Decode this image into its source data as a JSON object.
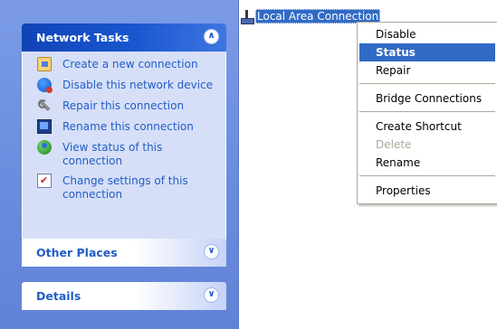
{
  "task_pane": {
    "network_tasks": {
      "title": "Network Tasks",
      "items": [
        {
          "label": "Create a new connection",
          "icon": "new-connection-icon"
        },
        {
          "label": "Disable this network device",
          "icon": "disable-device-icon"
        },
        {
          "label": "Repair this connection",
          "icon": "repair-icon"
        },
        {
          "label": "Rename this connection",
          "icon": "rename-icon"
        },
        {
          "label": "View status of this connection",
          "icon": "status-icon"
        },
        {
          "label": "Change settings of this connection",
          "icon": "settings-icon"
        }
      ]
    },
    "other_places": {
      "title": "Other Places"
    },
    "details": {
      "title": "Details"
    }
  },
  "connection": {
    "label": "Local Area Connection",
    "icon": "network-connection-icon"
  },
  "context_menu": {
    "items": [
      {
        "label": "Disable",
        "state": "normal"
      },
      {
        "label": "Status",
        "state": "default-selected"
      },
      {
        "label": "Repair",
        "state": "normal"
      },
      {
        "label": "Bridge Connections",
        "state": "normal"
      },
      {
        "label": "Create Shortcut",
        "state": "normal"
      },
      {
        "label": "Delete",
        "state": "disabled"
      },
      {
        "label": "Rename",
        "state": "normal"
      },
      {
        "label": "Properties",
        "state": "normal"
      }
    ]
  },
  "colors": {
    "pane_background": "#6d8fe0",
    "selection": "#316ac5",
    "task_link": "#215dc6",
    "group_body": "#d6dff7"
  }
}
